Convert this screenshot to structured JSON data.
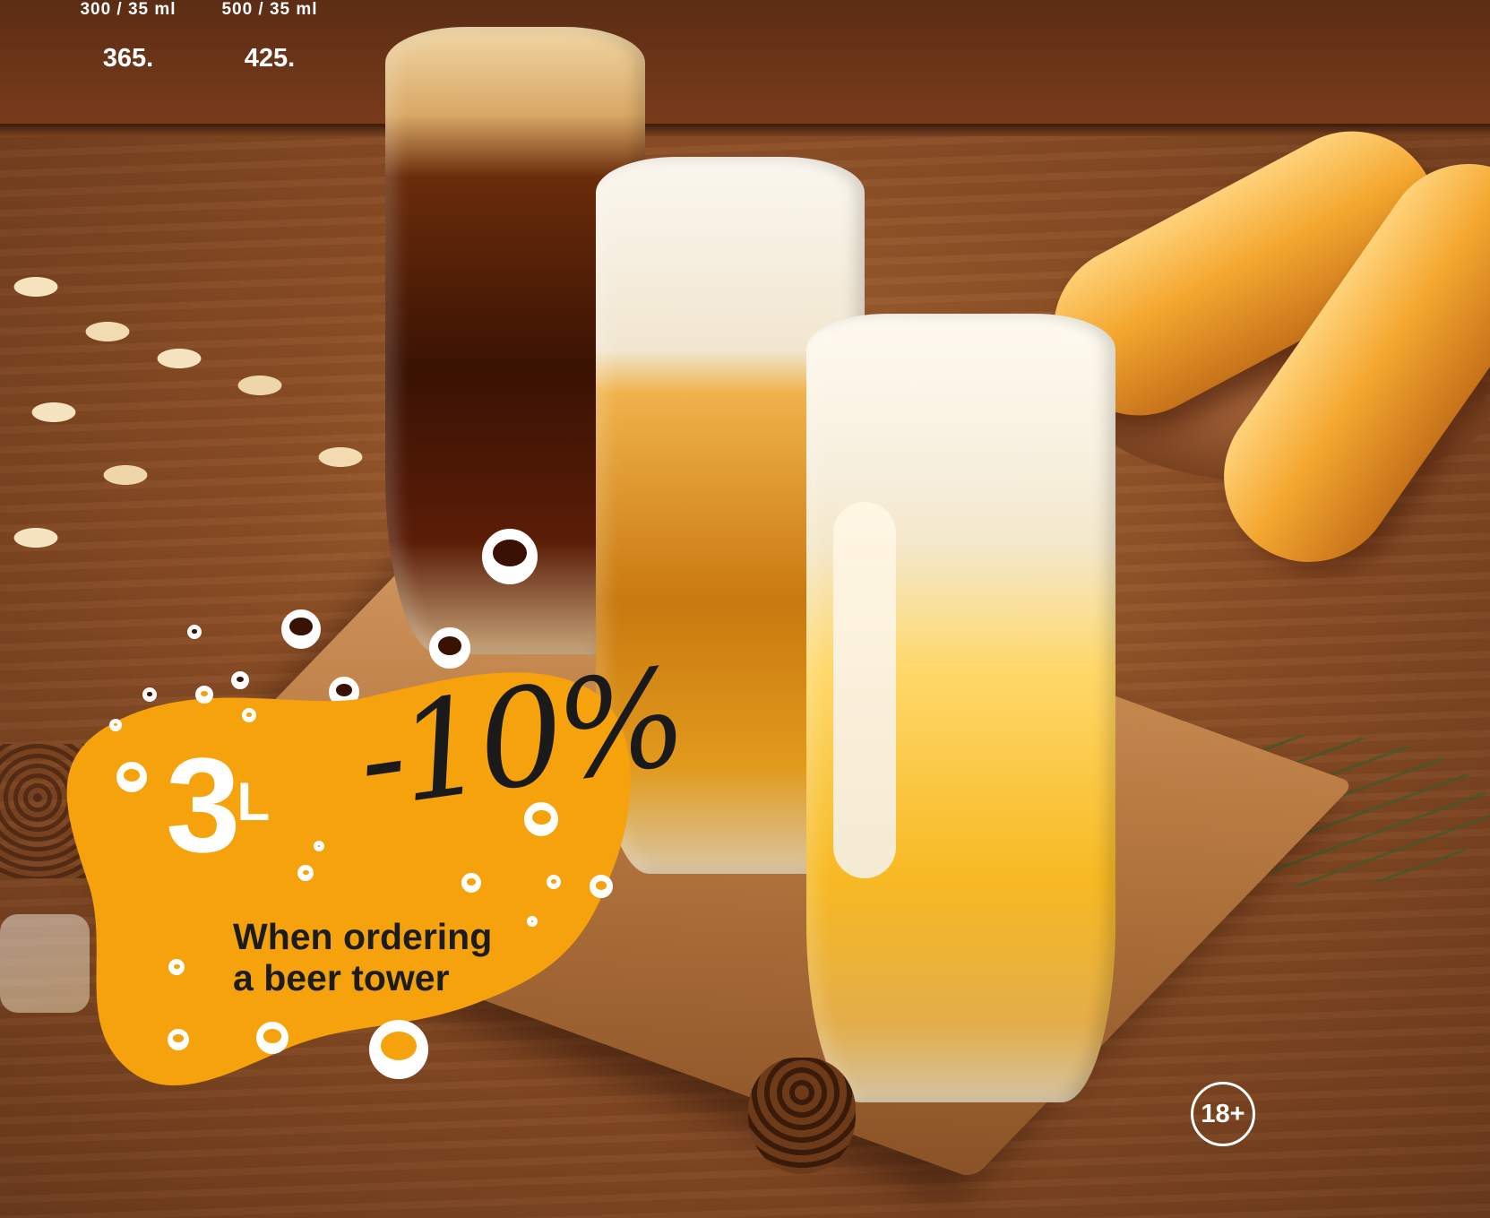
{
  "prices": [
    {
      "volume": "300 / 35  ml",
      "price": "365."
    },
    {
      "volume": "500 / 35  ml",
      "price": "425."
    }
  ],
  "promo": {
    "volume": "3",
    "volume_unit": "L",
    "discount": "-10%",
    "line1": "When ordering",
    "line2": "a beer tower",
    "color": "#f5a20d"
  },
  "age_badge": "18+"
}
